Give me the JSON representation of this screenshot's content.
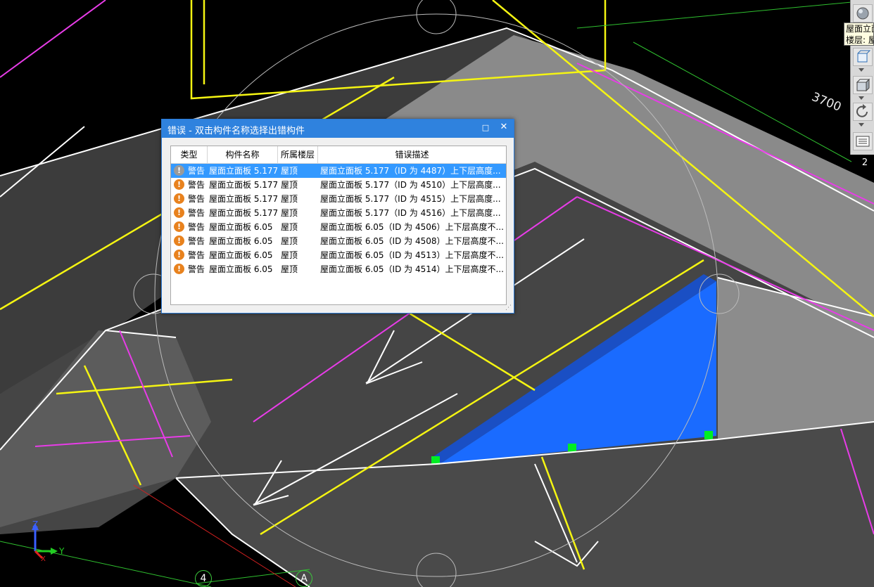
{
  "viewport": {
    "dimension_label": "3700",
    "grid_labels": [
      "4",
      "A",
      "2"
    ],
    "axes": {
      "z": "Z",
      "y": "Y",
      "x": "X"
    },
    "colors": {
      "background": "#000000",
      "slab": "#4a4a4a",
      "slab_light": "#8a8a8a",
      "selected_face": "#1a6bff",
      "grips": "#00ee22",
      "yellow": "#f5f512",
      "magenta": "#e83ce8"
    }
  },
  "toolbar": {
    "tooltip_line1": "屋面立面",
    "tooltip_line2": "楼层: 屋顶",
    "icons": [
      "view-sphere-icon",
      "view-box-icon",
      "view-cube-icon",
      "rotate-icon",
      "layer-list-icon"
    ]
  },
  "dialog": {
    "title": "错误 - 双击构件名称选择出错构件",
    "maximize_glyph": "□",
    "close_glyph": "✕",
    "columns": [
      "类型",
      "构件名称",
      "所属楼层",
      "错误描述"
    ],
    "rows": [
      {
        "type": "警告",
        "name": "屋面立面板 5.177",
        "floor": "屋顶",
        "desc": "屋面立面板 5.177（ID 为 4487）上下层高度...",
        "selected": true
      },
      {
        "type": "警告",
        "name": "屋面立面板 5.177",
        "floor": "屋顶",
        "desc": "屋面立面板 5.177（ID 为 4510）上下层高度...",
        "selected": false
      },
      {
        "type": "警告",
        "name": "屋面立面板 5.177",
        "floor": "屋顶",
        "desc": "屋面立面板 5.177（ID 为 4515）上下层高度...",
        "selected": false
      },
      {
        "type": "警告",
        "name": "屋面立面板 5.177",
        "floor": "屋顶",
        "desc": "屋面立面板 5.177（ID 为 4516）上下层高度...",
        "selected": false
      },
      {
        "type": "警告",
        "name": "屋面立面板 6.05",
        "floor": "屋顶",
        "desc": "屋面立面板 6.05（ID 为 4506）上下层高度不...",
        "selected": false
      },
      {
        "type": "警告",
        "name": "屋面立面板 6.05",
        "floor": "屋顶",
        "desc": "屋面立面板 6.05（ID 为 4508）上下层高度不...",
        "selected": false
      },
      {
        "type": "警告",
        "name": "屋面立面板 6.05",
        "floor": "屋顶",
        "desc": "屋面立面板 6.05（ID 为 4513）上下层高度不...",
        "selected": false
      },
      {
        "type": "警告",
        "name": "屋面立面板 6.05",
        "floor": "屋顶",
        "desc": "屋面立面板 6.05（ID 为 4514）上下层高度不...",
        "selected": false
      }
    ]
  }
}
